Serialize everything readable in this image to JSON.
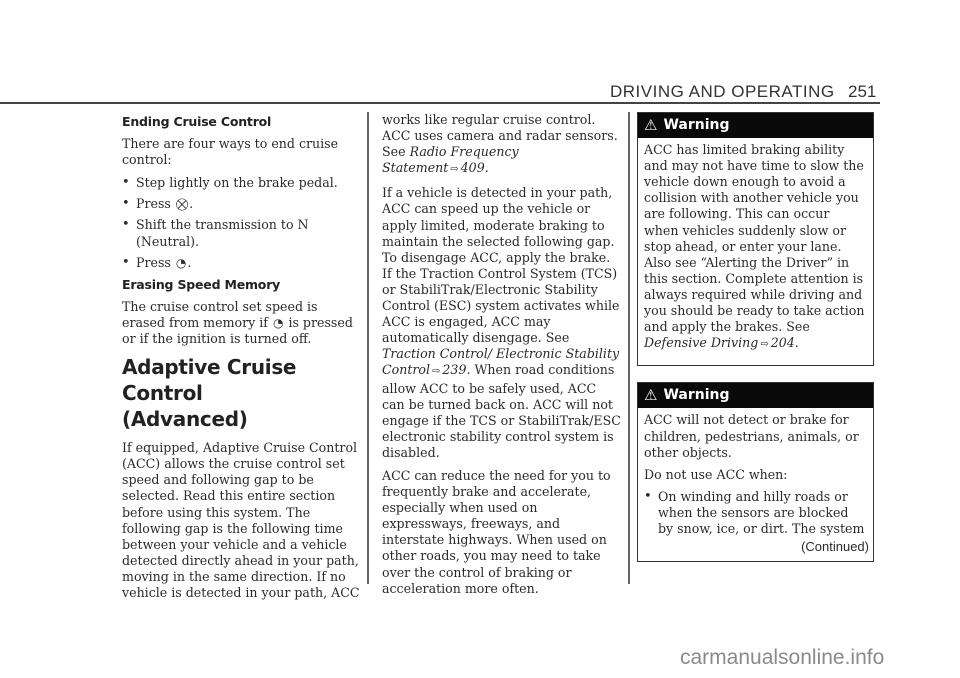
{
  "header": {
    "section_title": "DRIVING AND OPERATING",
    "page_number": "251"
  },
  "column1": {
    "ending_heading": "Ending Cruise Control",
    "ending_intro": "There are four ways to end cruise control:",
    "ending_bullets": [
      {
        "text": "Step lightly on the brake pedal."
      },
      {
        "prefix": "Press",
        "icon": "cruise-cancel-icon",
        "glyph": "⛒",
        "suffix": "."
      },
      {
        "text": "Shift the transmission to N (Neutral)."
      },
      {
        "prefix": "Press",
        "icon": "cruise-on-off-icon",
        "glyph": "◔",
        "suffix": "."
      }
    ],
    "erasing_heading": "Erasing Speed Memory",
    "erasing_text_before": "The cruise control set speed is erased from memory if",
    "erasing_icon_glyph": "◔",
    "erasing_text_after": "is pressed or if the ignition is turned off.",
    "acc_heading_line1": "Adaptive Cruise Control",
    "acc_heading_line2": "(Advanced)",
    "acc_intro": "If equipped, Adaptive Cruise Control (ACC) allows the cruise control set speed and following gap to be selected. Read this entire section before using this system. The following gap is the following time between your vehicle and a vehicle detected directly ahead in your path, moving in the same direction. If no vehicle is detected in your path, ACC"
  },
  "column2": {
    "p1_text": "works like regular cruise control. ACC uses camera and radar sensors. See",
    "p1_ref": "Radio Frequency Statement",
    "p1_ref_arrow": "⇨",
    "p1_ref_page": "409",
    "p1_end": ".",
    "p2_text": "If a vehicle is detected in your path, ACC can speed up the vehicle or apply limited, moderate braking to maintain the selected following gap. To disengage ACC, apply the brake. If the Traction Control System (TCS) or StabiliTrak/Electronic Stability Control (ESC) system activates while ACC is engaged, ACC may automatically disengage. See",
    "p2_ref": "Traction Control/ Electronic Stability Control",
    "p2_ref_arrow": "⇨",
    "p2_ref_page": "239",
    "p2_after": ". When road conditions allow ACC to be safely used, ACC can be turned back on. ACC will not engage if the TCS or StabiliTrak/ESC electronic stability control system is disabled.",
    "p3_text": "ACC can reduce the need for you to frequently brake and accelerate, especially when used on expressways, freeways, and interstate highways. When used on other roads, you may need to take over the control of braking or acceleration more often."
  },
  "column3": {
    "warning1": {
      "title": "Warning",
      "icon_glyph": "⚠",
      "text": "ACC has limited braking ability and may not have time to slow the vehicle down enough to avoid a collision with another vehicle you are following. This can occur when vehicles suddenly slow or stop ahead, or enter your lane. Also see “Alerting the Driver” in this section. Complete attention is always required while driving and you should be ready to take action and apply the brakes. See",
      "ref": "Defensive Driving",
      "ref_arrow": "⇨",
      "ref_page": "204",
      "end": "."
    },
    "warning2": {
      "title": "Warning",
      "icon_glyph": "⚠",
      "p1": "ACC will not detect or brake for children, pedestrians, animals, or other objects.",
      "p2": "Do not use ACC when:",
      "bullets": [
        "On winding and hilly roads or when the sensors are blocked by snow, ice, or dirt. The system"
      ],
      "continued": "(Continued)"
    }
  },
  "watermark": "carmanualsonline.info"
}
